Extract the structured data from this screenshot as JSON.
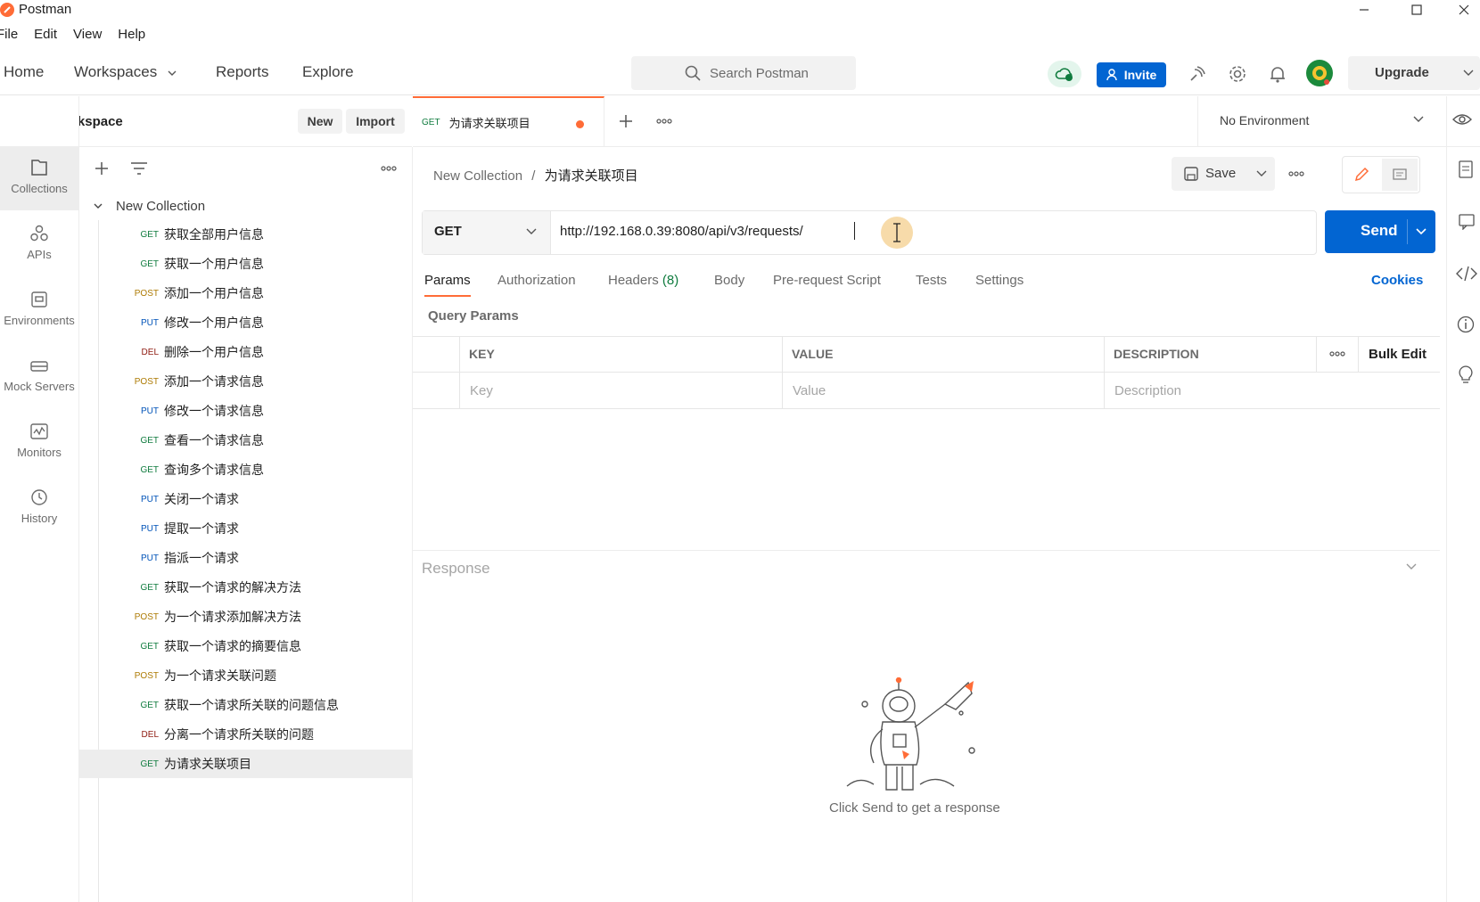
{
  "app": {
    "title": "Postman"
  },
  "menu": [
    "File",
    "Edit",
    "View",
    "Help"
  ],
  "header": {
    "nav": [
      "Home",
      "Workspaces",
      "Reports",
      "Explore"
    ],
    "search_placeholder": "Search Postman",
    "invite_label": "Invite",
    "upgrade_label": "Upgrade"
  },
  "workspace": {
    "name": "My Workspace",
    "new_label": "New",
    "import_label": "Import"
  },
  "rail": [
    {
      "label": "Collections",
      "icon": "collections-icon",
      "active": true
    },
    {
      "label": "APIs",
      "icon": "apis-icon"
    },
    {
      "label": "Environments",
      "icon": "environments-icon"
    },
    {
      "label": "Mock Servers",
      "icon": "mock-servers-icon"
    },
    {
      "label": "Monitors",
      "icon": "monitors-icon"
    },
    {
      "label": "History",
      "icon": "history-icon"
    }
  ],
  "collection": {
    "name": "New Collection",
    "requests": [
      {
        "method": "GET",
        "name": "获取全部用户信息"
      },
      {
        "method": "GET",
        "name": "获取一个用户信息"
      },
      {
        "method": "POST",
        "name": "添加一个用户信息"
      },
      {
        "method": "PUT",
        "name": "修改一个用户信息"
      },
      {
        "method": "DEL",
        "name": "删除一个用户信息"
      },
      {
        "method": "POST",
        "name": "添加一个请求信息"
      },
      {
        "method": "PUT",
        "name": "修改一个请求信息"
      },
      {
        "method": "GET",
        "name": "查看一个请求信息"
      },
      {
        "method": "GET",
        "name": "查询多个请求信息"
      },
      {
        "method": "PUT",
        "name": "关闭一个请求"
      },
      {
        "method": "PUT",
        "name": "提取一个请求"
      },
      {
        "method": "PUT",
        "name": "指派一个请求"
      },
      {
        "method": "GET",
        "name": "获取一个请求的解决方法"
      },
      {
        "method": "POST",
        "name": "为一个请求添加解决方法"
      },
      {
        "method": "GET",
        "name": "获取一个请求的摘要信息"
      },
      {
        "method": "POST",
        "name": "为一个请求关联问题"
      },
      {
        "method": "GET",
        "name": "获取一个请求所关联的问题信息"
      },
      {
        "method": "DEL",
        "name": "分离一个请求所关联的问题"
      },
      {
        "method": "GET",
        "name": "为请求关联项目",
        "selected": true
      }
    ]
  },
  "tab": {
    "method": "GET",
    "name": "为请求关联项目"
  },
  "environment": {
    "selected": "No Environment"
  },
  "breadcrumb": {
    "collection": "New Collection",
    "separator": "/",
    "request": "为请求关联项目"
  },
  "save_label": "Save",
  "request": {
    "method": "GET",
    "url": "http://192.168.0.39:8080/api/v3/requests/",
    "send_label": "Send"
  },
  "request_tabs": [
    "Params",
    "Authorization",
    "Headers",
    "Body",
    "Pre-request Script",
    "Tests",
    "Settings"
  ],
  "headers_count": "(8)",
  "cookies_label": "Cookies",
  "query_params": {
    "title": "Query Params",
    "columns": [
      "KEY",
      "VALUE",
      "DESCRIPTION"
    ],
    "bulk_edit": "Bulk Edit",
    "placeholders": [
      "Key",
      "Value",
      "Description"
    ]
  },
  "response": {
    "title": "Response",
    "empty_hint": "Click Send to get a response"
  },
  "colors": {
    "accent_orange": "#ff6c37",
    "primary_blue": "#0265d2",
    "get": "#0f7b3e",
    "post": "#ad7a03",
    "put": "#0053b8",
    "del": "#8e1a10"
  }
}
